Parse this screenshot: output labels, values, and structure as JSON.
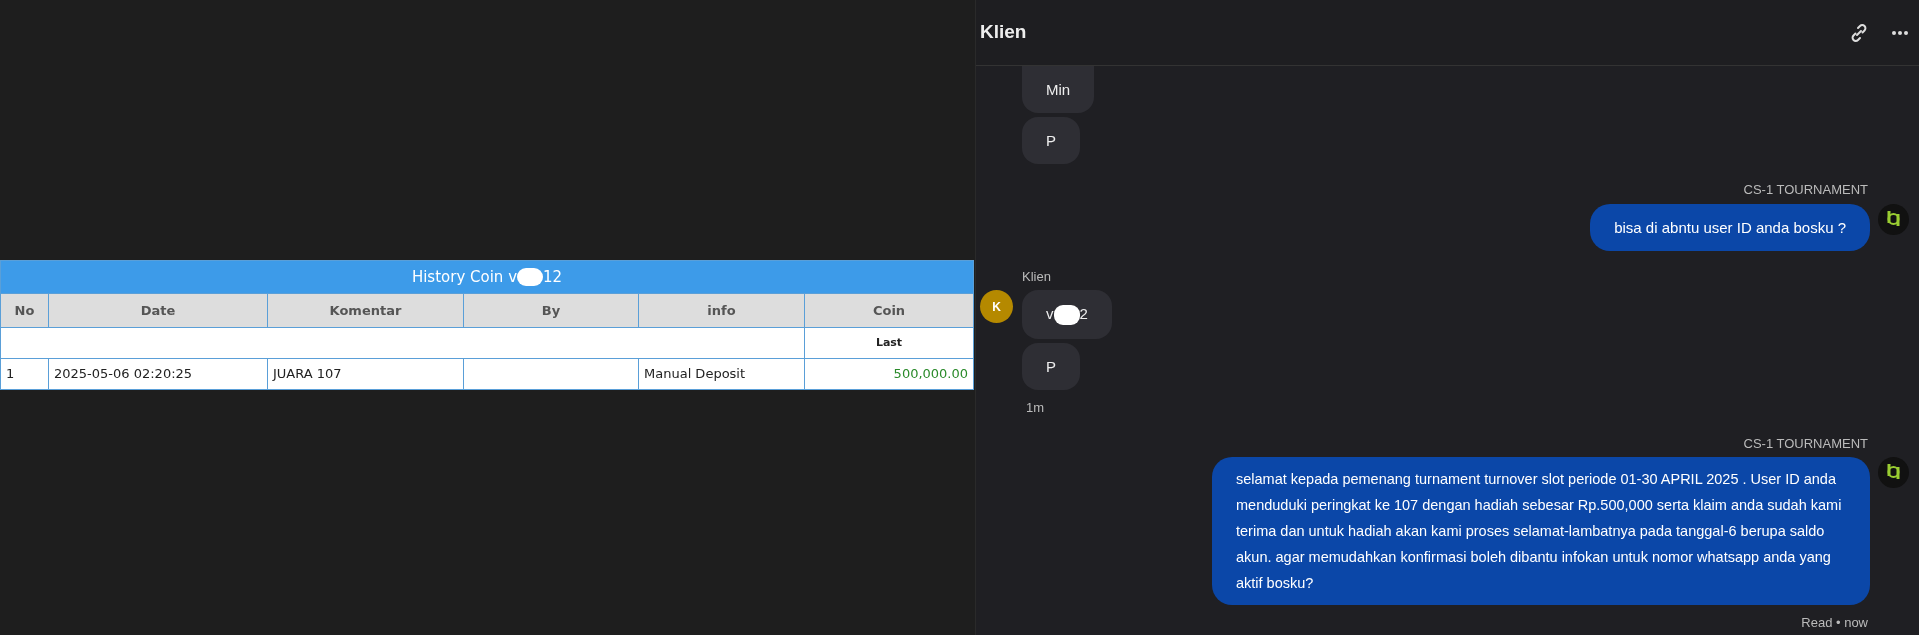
{
  "history_table": {
    "title_parts": [
      "History Coin v",
      "12"
    ],
    "columns": [
      "No",
      "Date",
      "Komentar",
      "By",
      "info",
      "Coin"
    ],
    "subheader": "Last",
    "rows": [
      {
        "no": "1",
        "date": "2025-05-06 02:20:25",
        "komentar": "JUARA 107",
        "by": "",
        "info": "Manual Deposit",
        "coin": "500,000.00"
      }
    ]
  },
  "chat": {
    "title": "Klien",
    "groups": [
      {
        "kind": "client",
        "bubbles": [
          {
            "parts": [
              "Min"
            ]
          },
          {
            "parts": [
              "P"
            ]
          }
        ]
      },
      {
        "kind": "agent",
        "sender": "CS-1 TOURNAMENT",
        "bubbles": [
          {
            "parts": [
              "bisa di abntu user ID anda bosku ?"
            ]
          }
        ]
      },
      {
        "kind": "client",
        "sender": "Klien",
        "avatar": "K",
        "bubbles": [
          {
            "parts": [
              "v",
              "2"
            ]
          },
          {
            "parts": [
              "P"
            ]
          }
        ],
        "time": "1m"
      },
      {
        "kind": "agent",
        "sender": "CS-1 TOURNAMENT",
        "bubbles": [
          {
            "parts": [
              "selamat kepada pemenang turnament turnover slot periode 01-30 APRIL 2025 . User ID anda menduduki peringkat ke 107 dengan hadiah sebesar Rp.500,000 serta klaim anda sudah kami terima dan untuk hadiah akan kami proses selamat-lambatnya pada tanggal-6 berupa saldo akun. agar memudahkan konfirmasi boleh dibantu infokan untuk nomor whatsapp anda yang aktif bosku?"
            ]
          }
        ],
        "status": "Read • now"
      }
    ]
  }
}
